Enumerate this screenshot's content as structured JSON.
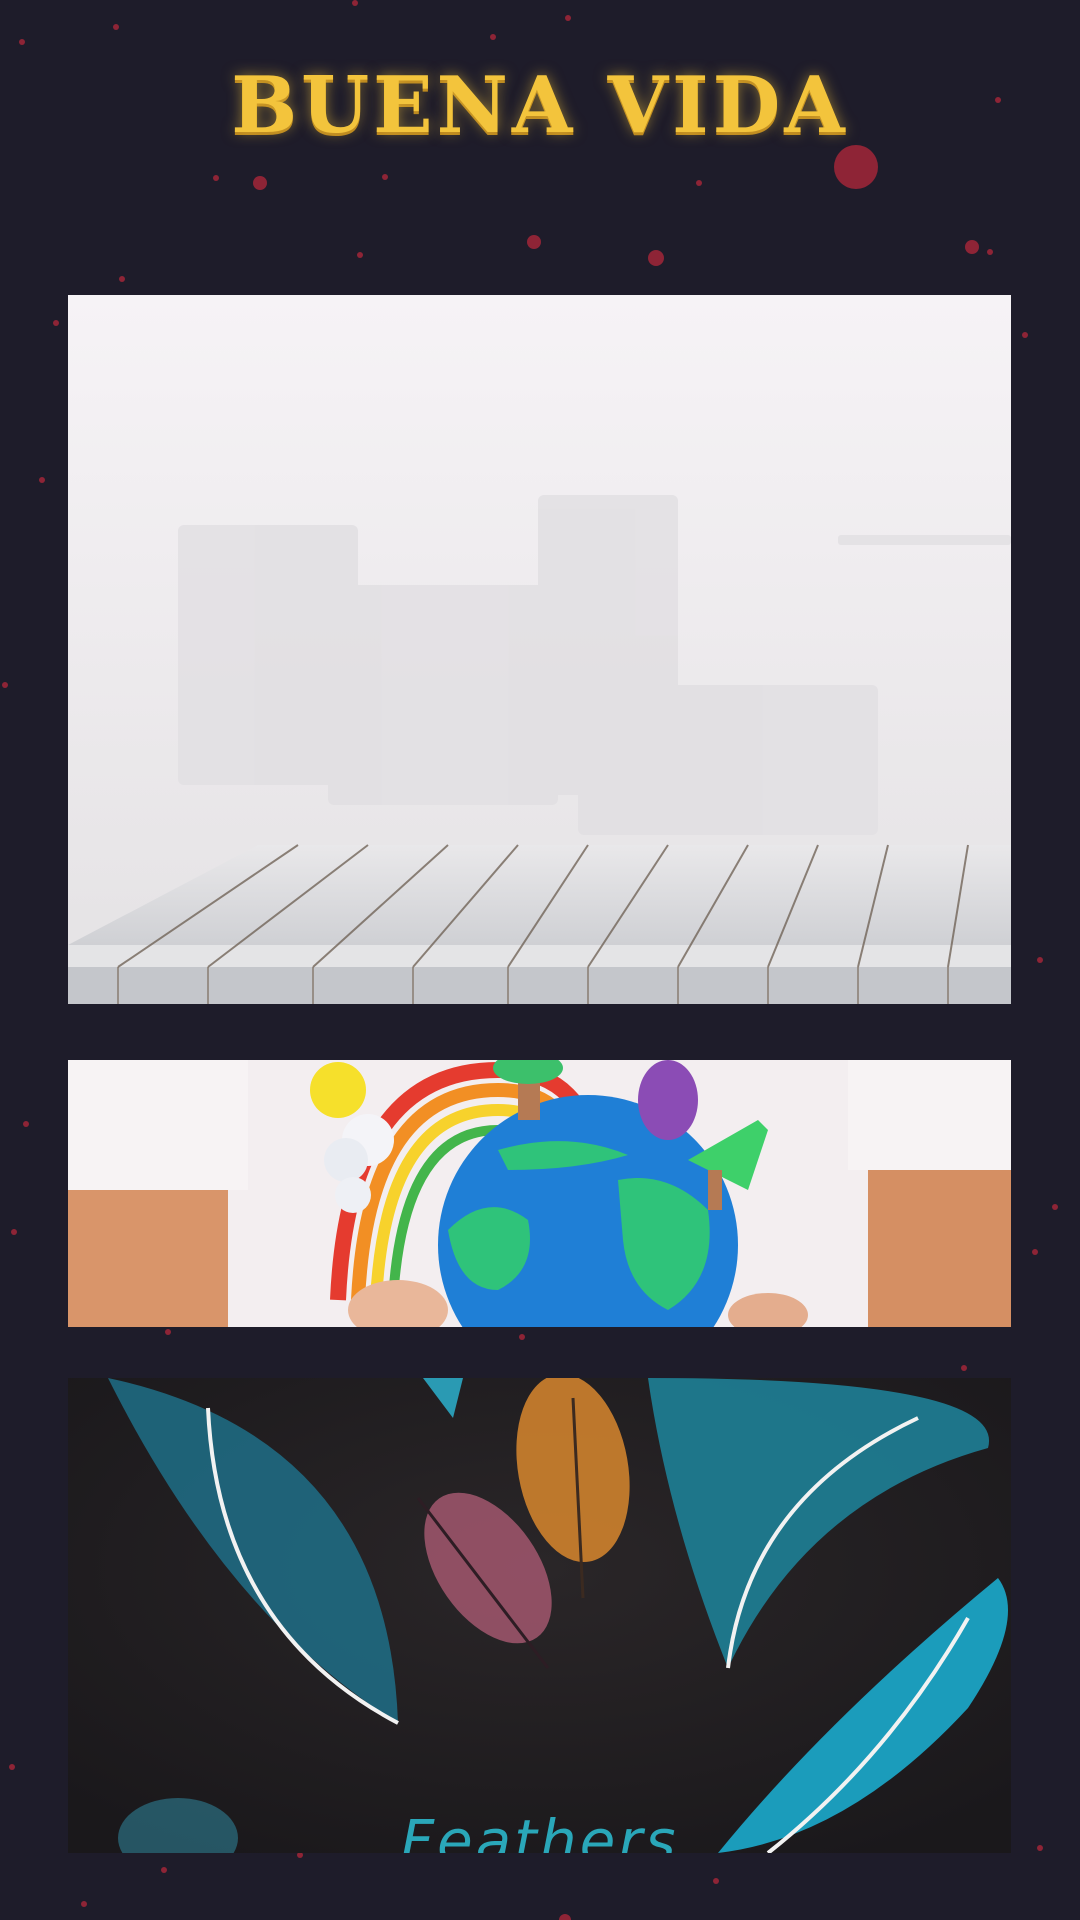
{
  "header": {
    "title": "BUENA VIDA"
  },
  "colors": {
    "background": "#1e1c2a",
    "title": "#f3c43c",
    "dots": "#8e2436",
    "feathers_text": "#2aa7b9"
  },
  "gallery": {
    "items": [
      {
        "name": "white-wood-table-photo"
      },
      {
        "name": "clay-globe-photo"
      },
      {
        "name": "feathers-poster",
        "caption": "Feathers"
      }
    ]
  }
}
